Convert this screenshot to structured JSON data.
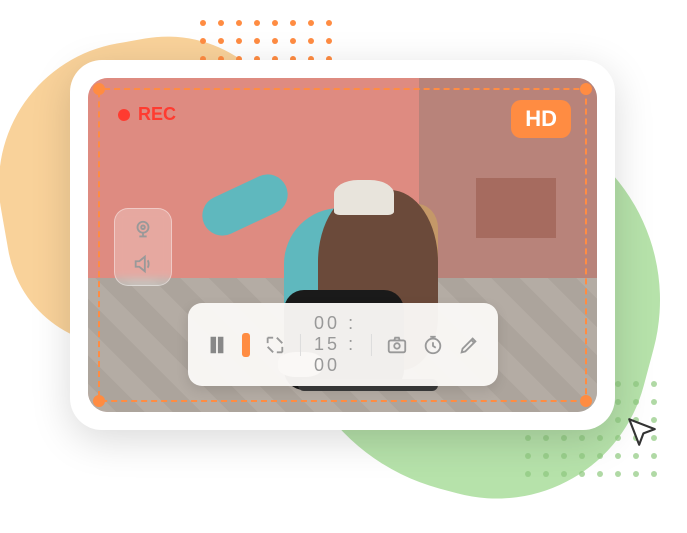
{
  "rec": {
    "label": "REC"
  },
  "hd": {
    "label": "HD"
  },
  "timer": {
    "display": "00 : 15 : 00"
  },
  "icons": {
    "webcam": "webcam-icon",
    "speaker": "speaker-icon",
    "pause": "pause-icon",
    "stop": "stop-icon",
    "fullscreen": "fullscreen-icon",
    "camera": "camera-icon",
    "clock": "clock-icon",
    "pencil": "pencil-icon",
    "cursor": "cursor-icon"
  },
  "colors": {
    "accent": "#ff8c42",
    "rec": "#ff3b30",
    "blob_orange": "#f9d29a",
    "blob_green": "#b6e2aa"
  }
}
